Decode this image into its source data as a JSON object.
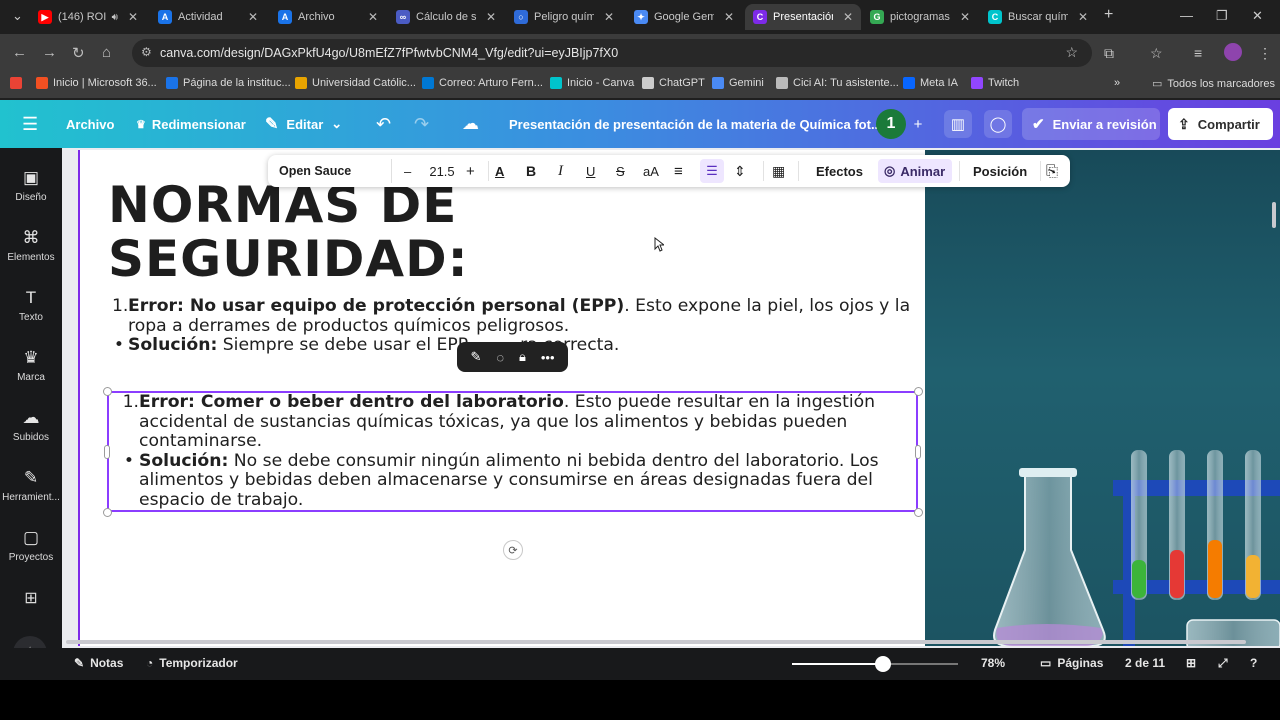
{
  "browser": {
    "tabs": [
      {
        "title": "(146) ROI",
        "color": "#ff0000",
        "glyph": "▶",
        "audio": true
      },
      {
        "title": "Actividad",
        "color": "#1a73e8",
        "glyph": "A"
      },
      {
        "title": "Archivo",
        "color": "#1a73e8",
        "glyph": "A"
      },
      {
        "title": "Cálculo de su",
        "color": "#4b5cc4",
        "glyph": "∞"
      },
      {
        "title": "Peligro quími",
        "color": "#2f6bd8",
        "glyph": "○"
      },
      {
        "title": "Google Gemi",
        "color": "#4a8af4",
        "glyph": "✦"
      },
      {
        "title": "Presentación",
        "color": "#7d2ae8",
        "glyph": "C",
        "active": true
      },
      {
        "title": "pictogramas",
        "color": "#34a853",
        "glyph": "G"
      },
      {
        "title": "Buscar quími",
        "color": "#00c4cc",
        "glyph": "C"
      }
    ],
    "url": "canva.com/design/DAGxPkfU4go/U8mEfZ7fPfwtvbCNM4_Vfg/edit?ui=eyJBIjp7fX0",
    "bookmarks": [
      {
        "label": "Inicio | Microsoft 36...",
        "color": "#f25022"
      },
      {
        "label": "Página de la instituc...",
        "color": "#1a73e8"
      },
      {
        "label": "Universidad Católic...",
        "color": "#e8a400"
      },
      {
        "label": "Correo: Arturo Fern...",
        "color": "#0078d4"
      },
      {
        "label": "Inicio - Canva",
        "color": "#00c4cc"
      },
      {
        "label": "ChatGPT",
        "color": "#cccccc"
      },
      {
        "label": "Gemini",
        "color": "#4a8af4"
      },
      {
        "label": "Cici AI: Tu asistente...",
        "color": "#bbbbbb"
      },
      {
        "label": "Meta IA",
        "color": "#0866ff"
      },
      {
        "label": "Twitch",
        "color": "#9146ff"
      }
    ],
    "all_bookmarks": "Todos los marcadores"
  },
  "canva_header": {
    "archivo": "Archivo",
    "redimensionar": "Redimensionar",
    "editar": "Editar",
    "doc_title": "Presentación de presentación de la materia de Química fot...",
    "collaborator_count": "1",
    "review": "Enviar a revisión",
    "share": "Compartir"
  },
  "rail": [
    {
      "label": "Diseño",
      "icon": "▣"
    },
    {
      "label": "Elementos",
      "icon": "⌘"
    },
    {
      "label": "Texto",
      "icon": "T"
    },
    {
      "label": "Marca",
      "icon": "♛"
    },
    {
      "label": "Subidos",
      "icon": "☁"
    },
    {
      "label": "Herramient...",
      "icon": "✎"
    },
    {
      "label": "Proyectos",
      "icon": "▢"
    }
  ],
  "text_toolbar": {
    "font": "Open Sauce",
    "size": "21.5",
    "effects": "Efectos",
    "animate": "Animar",
    "position": "Posición"
  },
  "slide": {
    "title_line1": "NORMAS DE",
    "title_line2": "SEGURIDAD:",
    "item1": {
      "num": "1.",
      "error_label": "Error: No usar equipo de protección personal (EPP)",
      "error_text_a": ". Esto expone la piel, los ojos y la",
      "error_text_b": "ropa a derrames de productos químicos peligrosos.",
      "solution_label": "Solución:",
      "solution_text_a": " Siempre se debe usar el EPP",
      "solution_text_b": "ra correcta."
    },
    "item2": {
      "num": "1.",
      "error_label": "Error: Comer o beber dentro del laboratorio",
      "error_text_a": ". Esto puede resultar en la ingestión",
      "error_text_b": "accidental de sustancias químicas tóxicas, ya que los alimentos y bebidas pueden",
      "error_text_c": "contaminarse.",
      "solution_label": "Solución:",
      "solution_text_a": " No se debe consumir ningún alimento ni bebida dentro del laboratorio. Los",
      "solution_text_b": "alimentos y bebidas deben almacenarse y consumirse en áreas designadas fuera del",
      "solution_text_c": "espacio de trabajo."
    }
  },
  "bottom_bar": {
    "notes": "Notas",
    "timer": "Temporizador",
    "zoom": "78%",
    "zoom_fraction": 0.55,
    "pages": "Páginas",
    "page_indicator": "2 de 11"
  }
}
